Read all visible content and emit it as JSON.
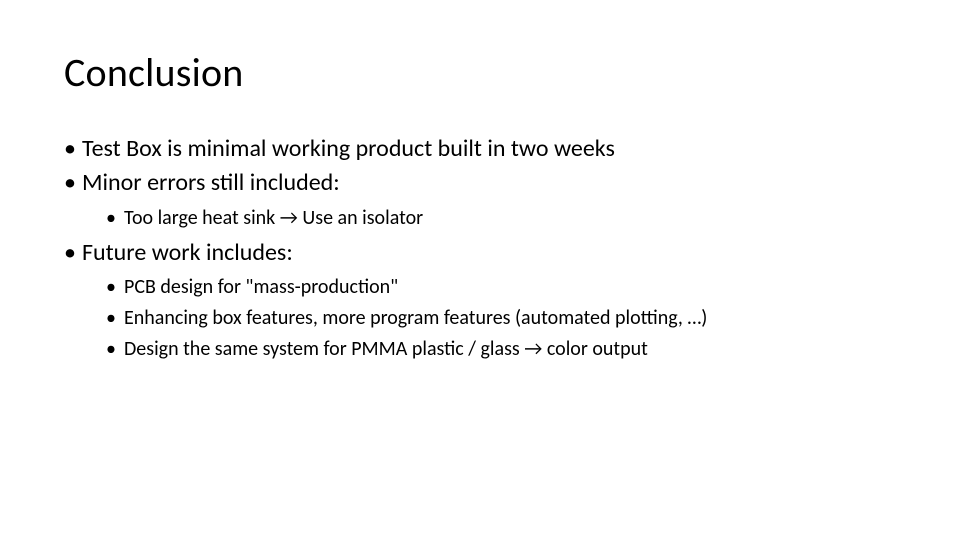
{
  "slide": {
    "title": "Conclusion",
    "bullets": [
      {
        "text": "Test Box is minimal working product built in two weeks"
      },
      {
        "text": "Minor errors still included:",
        "children": [
          "Too large heat sink → Use an isolator"
        ]
      },
      {
        "text": "Future work includes:",
        "children": [
          "PCB design for \"mass-production\"",
          "Enhancing box features, more program features (automated plotting, …)",
          "Design the same system for PMMA plastic / glass → color output"
        ]
      }
    ]
  }
}
